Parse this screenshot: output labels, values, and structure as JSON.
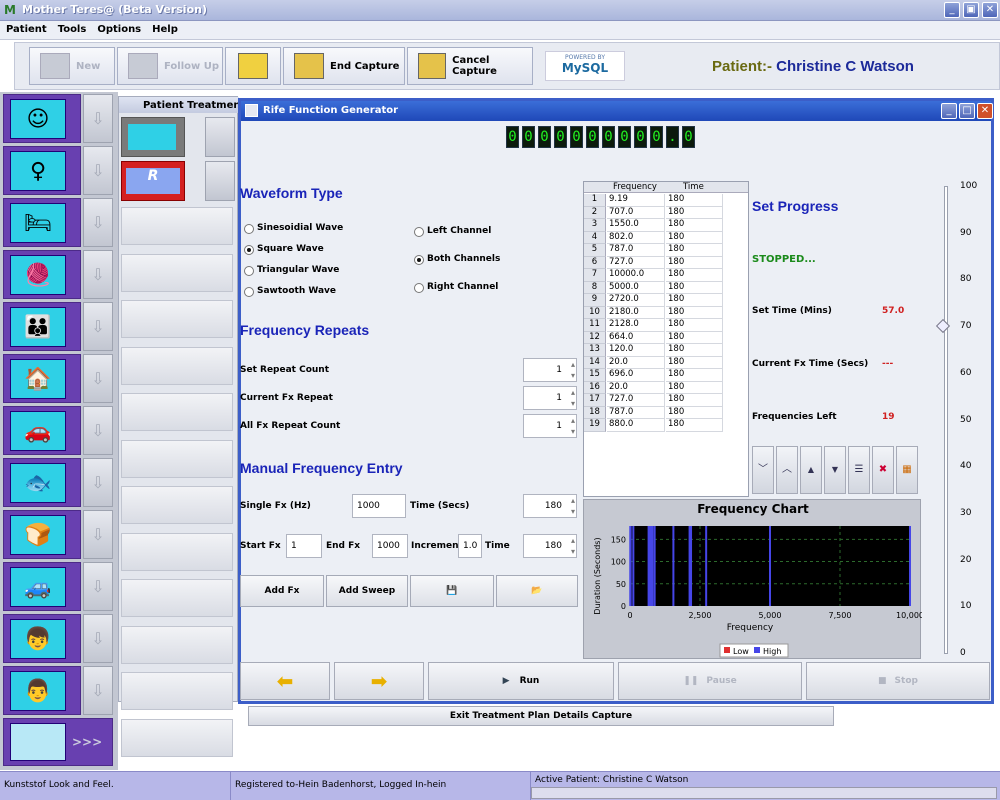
{
  "window": {
    "title": "Mother Teres@ (Beta Version)",
    "min": "_",
    "restore": "▣",
    "close": "✕"
  },
  "menu": [
    "Patient",
    "Tools",
    "Options",
    "Help"
  ],
  "toolbar": {
    "new": "New",
    "follow_up": "Follow Up",
    "end_capture": "End Capture",
    "cancel_capture": "Cancel Capture",
    "mysql_top": "POWERED BY",
    "mysql": "MySQL"
  },
  "patient": {
    "prefix": "Patient:-",
    "name": "Christine C Watson"
  },
  "left_more": ">>>",
  "panel2_title": "Patient Treatment Pla",
  "rife": {
    "title": "Rife Function Generator",
    "digits": [
      "0",
      "0",
      "0",
      "0",
      "0",
      "0",
      "0",
      "0",
      "0",
      "0",
      ".",
      "0"
    ],
    "waveform_title": "Waveform Type",
    "waves": [
      "Sinesoidial Wave",
      "Square Wave",
      "Triangular Wave",
      "Sawtooth Wave"
    ],
    "channels": [
      "Left Channel",
      "Both Channels",
      "Right Channel"
    ],
    "repeats_title": "Frequency Repeats",
    "set_repeat": "Set Repeat Count",
    "set_repeat_val": "1",
    "current_repeat": "Current Fx Repeat",
    "current_repeat_val": "1",
    "all_repeat": "All Fx Repeat Count",
    "all_repeat_val": "1",
    "manual_title": "Manual Frequency Entry",
    "single_fx": "Single Fx (Hz)",
    "single_fx_val": "1000",
    "time_secs": "Time (Secs)",
    "time_secs_val": "180",
    "start_fx": "Start Fx",
    "start_fx_val": "1",
    "end_fx": "End Fx",
    "end_fx_val": "1000",
    "increment": "Increment",
    "increment_val": "1.0",
    "time": "Time",
    "time_val": "180",
    "add_fx": "Add Fx",
    "add_sweep": "Add Sweep",
    "save_icon": "💾",
    "open_icon": "📂",
    "table_cols": [
      "Frequency",
      "Time"
    ],
    "table_rows": [
      [
        "1",
        "9.19",
        "180"
      ],
      [
        "2",
        "707.0",
        "180"
      ],
      [
        "3",
        "1550.0",
        "180"
      ],
      [
        "4",
        "802.0",
        "180"
      ],
      [
        "5",
        "787.0",
        "180"
      ],
      [
        "6",
        "727.0",
        "180"
      ],
      [
        "7",
        "10000.0",
        "180"
      ],
      [
        "8",
        "5000.0",
        "180"
      ],
      [
        "9",
        "2720.0",
        "180"
      ],
      [
        "10",
        "2180.0",
        "180"
      ],
      [
        "11",
        "2128.0",
        "180"
      ],
      [
        "12",
        "664.0",
        "180"
      ],
      [
        "13",
        "120.0",
        "180"
      ],
      [
        "14",
        "20.0",
        "180"
      ],
      [
        "15",
        "696.0",
        "180"
      ],
      [
        "16",
        "20.0",
        "180"
      ],
      [
        "17",
        "727.0",
        "180"
      ],
      [
        "18",
        "787.0",
        "180"
      ],
      [
        "19",
        "880.0",
        "180"
      ]
    ],
    "progress_title": "Set Progress",
    "status": "STOPPED...",
    "set_time": "Set Time (Mins)",
    "set_time_val": "57.0",
    "current_fx_time": "Current Fx Time (Secs)",
    "current_fx_time_val": "---",
    "freq_left": "Frequencies Left",
    "freq_left_val": "19",
    "slider_ticks": [
      "100",
      "90",
      "80",
      "70",
      "60",
      "50",
      "40",
      "30",
      "20",
      "10",
      "0"
    ],
    "slider_value": 70,
    "run": "Run",
    "pause": "Pause",
    "stop": "Stop",
    "exit": "Exit Treatment Plan Details Capture"
  },
  "chart_data": {
    "type": "bar",
    "title": "Frequency Chart",
    "xlabel": "Frequency",
    "ylabel": "Duration (Seconds)",
    "xlim": [
      0,
      10000
    ],
    "ylim": [
      0,
      180
    ],
    "xticks": [
      "0",
      "2,500",
      "5,000",
      "7,500",
      "10,000"
    ],
    "yticks": [
      "0",
      "50",
      "100",
      "150"
    ],
    "legend": [
      "Low",
      "High"
    ],
    "colors": {
      "low": "#e03030",
      "high": "#4646e8",
      "bg": "#000000",
      "grid": "#2c6a2c"
    },
    "series": [
      {
        "name": "High",
        "x": [
          9.19,
          707,
          1550,
          802,
          787,
          727,
          10000,
          5000,
          2720,
          2180,
          2128,
          664,
          120,
          20,
          696,
          20,
          727,
          787,
          880
        ],
        "y": [
          180,
          180,
          180,
          180,
          180,
          180,
          180,
          180,
          180,
          180,
          180,
          180,
          180,
          180,
          180,
          180,
          180,
          180,
          180
        ]
      }
    ]
  },
  "status_bar": {
    "laf": "Kunststof Look and Feel.",
    "reg": "Registered to-Hein Badenhorst, Logged In-hein",
    "active": "Active Patient: Christine C Watson"
  }
}
